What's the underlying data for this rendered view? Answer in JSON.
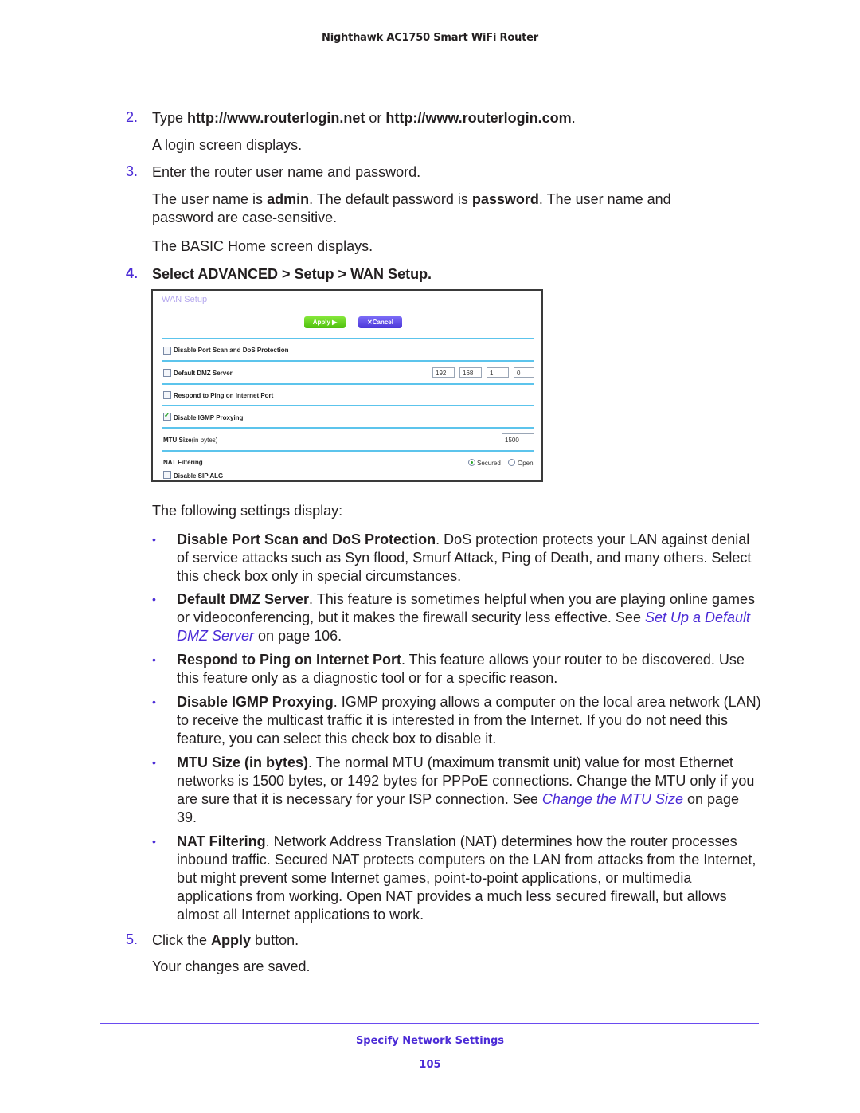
{
  "header": {
    "title": "Nighthawk AC1750 Smart WiFi Router"
  },
  "steps": {
    "s2": {
      "num": "2.",
      "pre": "Type ",
      "url1": "http://www.routerlogin.net",
      "mid": " or ",
      "url2": "http://www.routerlogin.com",
      "post": ".",
      "note": "A login screen displays."
    },
    "s3": {
      "num": "3.",
      "text": "Enter the router user name and password.",
      "p1_pre": "The user name is ",
      "p1_user": "admin",
      "p1_mid": ". The default password is ",
      "p1_pass": "password",
      "p1_post": ". The user name and password are case-sensitive.",
      "p2": "The BASIC Home screen displays."
    },
    "s4": {
      "num": "4.",
      "text": "Select ADVANCED > Setup > WAN Setup."
    },
    "after_panel": "The following settings display:",
    "s5": {
      "num": "5.",
      "pre": "Click the ",
      "bold": "Apply",
      "post": " button.",
      "note": "Your changes are saved."
    }
  },
  "wan_panel": {
    "title": "WAN Setup",
    "apply_label": "Apply ▶",
    "cancel_label": "✕Cancel",
    "disable_port_scan": {
      "label": "Disable Port Scan and DoS Protection",
      "checked": false
    },
    "default_dmz": {
      "label": "Default DMZ Server",
      "checked": false,
      "ip": [
        "192",
        "168",
        "1",
        "0"
      ]
    },
    "respond_ping": {
      "label": "Respond to Ping on Internet Port",
      "checked": false
    },
    "disable_igmp": {
      "label": "Disable IGMP Proxying",
      "checked": true
    },
    "mtu": {
      "label_bold": "MTU Size",
      "label_rest": "(in bytes)",
      "value": "1500"
    },
    "nat": {
      "label": "NAT Filtering",
      "options": [
        "Secured",
        "Open"
      ],
      "selected": "Secured"
    },
    "disable_sip": {
      "label": "Disable SIP ALG",
      "checked": false
    }
  },
  "bullets": [
    {
      "title": "Disable Port Scan and DoS Protection",
      "text": ". DoS protection protects your LAN against denial of service attacks such as Syn flood, Smurf Attack, Ping of Death, and many others. Select this check box only in special circumstances."
    },
    {
      "title": "Default DMZ Server",
      "text": ". This feature is sometimes helpful when you are playing online games or videoconferencing, but it makes the firewall security less effective. See ",
      "link": "Set Up a Default DMZ Server",
      "after": " on page 106."
    },
    {
      "title": "Respond to Ping on Internet Port",
      "text": ". This feature allows your router to be discovered. Use this feature only as a diagnostic tool or for a specific reason."
    },
    {
      "title": "Disable IGMP Proxying",
      "text": ". IGMP proxying allows a computer on the local area network (LAN) to receive the multicast traffic it is interested in from the Internet. If you do not need this feature, you can select this check box to disable it."
    },
    {
      "title": "MTU Size (in bytes)",
      "text": ". The normal MTU (maximum transmit unit) value for most Ethernet networks is 1500 bytes, or 1492 bytes for PPPoE connections. Change the MTU only if you are sure that it is necessary for your ISP connection. See ",
      "link": "Change the MTU Size",
      "after": " on page 39."
    },
    {
      "title": "NAT Filtering",
      "text": ". Network Address Translation (NAT) determines how the router processes inbound traffic. Secured NAT protects computers on the LAN from attacks from the Internet, but might prevent some Internet games, point-to-point applications, or multimedia applications from working. Open NAT provides a much less secured firewall, but allows almost all Internet applications to work."
    }
  ],
  "bullet_glyph": "•",
  "footer": {
    "section": "Specify Network Settings",
    "page": "105"
  }
}
